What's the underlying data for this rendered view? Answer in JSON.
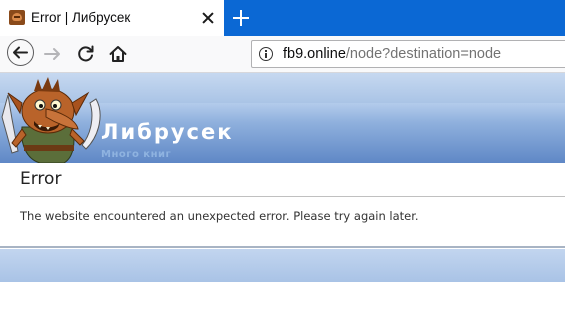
{
  "browser": {
    "tab": {
      "title": "Error | Либрусек"
    },
    "url": {
      "domain": "fb9.online",
      "path": "/node?destination=node"
    }
  },
  "site": {
    "name": "Либрусек",
    "slogan": "Много книг"
  },
  "page": {
    "title": "Error",
    "message": "The website encountered an unexpected error. Please try again later."
  },
  "colors": {
    "tabstrip": "#0b68d4",
    "header_gradient_top": "#a9c3e6",
    "header_gradient_bottom": "#5f88c6",
    "site_name": "#ffffff",
    "slogan": "#8fb3e0"
  },
  "icons": [
    "site-favicon-icon",
    "close-icon",
    "plus-icon",
    "back-arrow-icon",
    "forward-arrow-icon",
    "reload-icon",
    "home-icon",
    "info-icon",
    "goblin-logo"
  ]
}
